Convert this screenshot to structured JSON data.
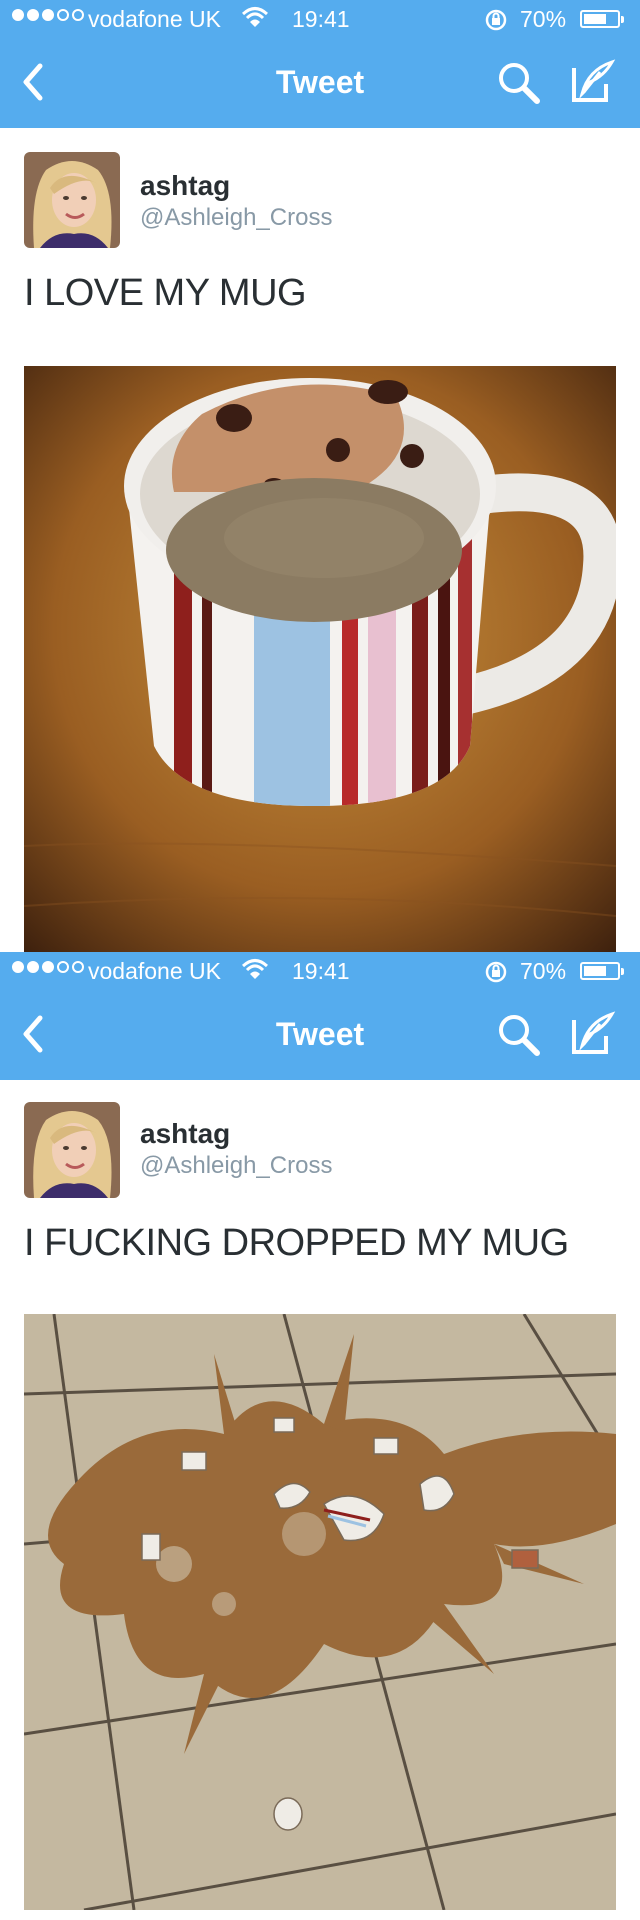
{
  "status_bar": {
    "carrier": "vodafone UK",
    "time": "19:41",
    "battery_percent": "70%",
    "signal_strength": 3,
    "signal_max": 5,
    "battery_level": 0.7
  },
  "nav": {
    "title": "Tweet",
    "icons": [
      "chevron-left-icon",
      "search-icon",
      "compose-icon"
    ]
  },
  "colors": {
    "brand": "#55acee",
    "name": "#292f33",
    "handle": "#8899a6"
  },
  "tweets": [
    {
      "user": {
        "name": "ashtag",
        "handle": "@Ashleigh_Cross"
      },
      "text": "I LOVE MY MUG",
      "photo": "striped-mug-photo"
    },
    {
      "user": {
        "name": "ashtag",
        "handle": "@Ashleigh_Cross"
      },
      "text": "I FUCKING DROPPED MY MUG",
      "photo": "broken-mug-spill-photo"
    }
  ]
}
